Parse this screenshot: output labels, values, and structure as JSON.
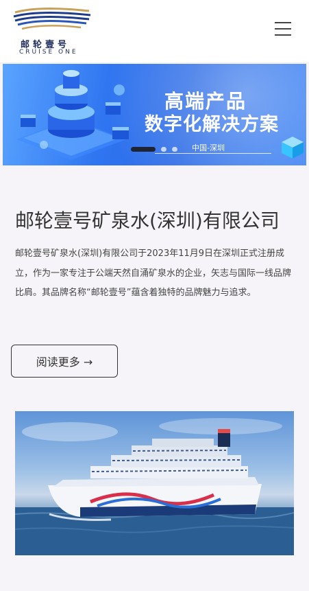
{
  "header": {
    "logo_cn": "邮轮壹号",
    "logo_en": "CRUISE ONE"
  },
  "banner": {
    "title": "高端产品",
    "subtitle": "数字化解决方案",
    "location": "中国-深圳",
    "slides_total": 3,
    "slide_active": 1
  },
  "company": {
    "title": "邮轮壹号矿泉水(深圳)有限公司",
    "intro": "邮轮壹号矿泉水(深圳)有限公司于2023年11月9日在深圳正式注册成立，作为一家专注于公端天然自涌矿泉水的企业，矢志与国际一线品牌比肩。其品牌名称“邮轮壹号”蕴含着独特的品牌魅力与追求。",
    "read_more_label": "阅读更多 →"
  },
  "colors": {
    "brand_navy": "#1f2d5c",
    "banner_blue": "#2f74f0",
    "page_bg": "#f6f4f8"
  },
  "icons": {
    "menu": "hamburger-menu-icon"
  }
}
